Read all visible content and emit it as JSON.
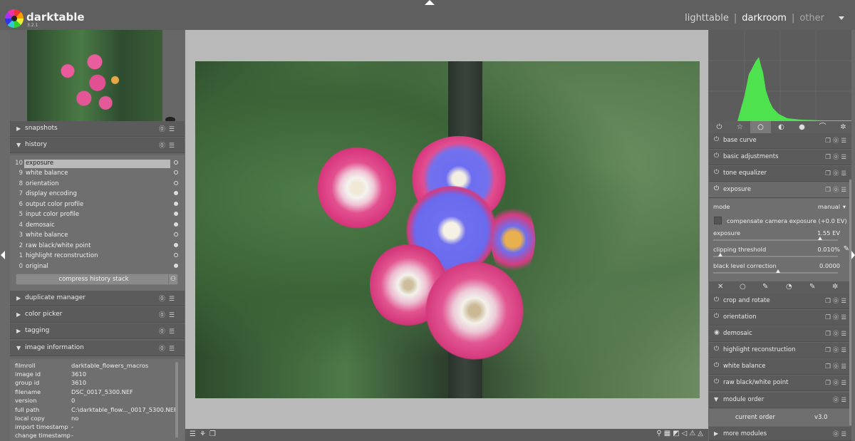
{
  "app": {
    "title": "darktable",
    "version": "3.2.1"
  },
  "views": {
    "lighttable": "lighttable",
    "sep1": "|",
    "darkroom": "darkroom",
    "sep2": "|",
    "other": "other"
  },
  "left_modules": {
    "snapshots": "snapshots",
    "history": "history",
    "duplicate_manager": "duplicate manager",
    "color_picker": "color picker",
    "tagging": "tagging",
    "image_information": "image information"
  },
  "history": [
    {
      "n": "10",
      "label": "exposure"
    },
    {
      "n": "9",
      "label": "white balance"
    },
    {
      "n": "8",
      "label": "orientation"
    },
    {
      "n": "7",
      "label": "display encoding"
    },
    {
      "n": "6",
      "label": "output color profile"
    },
    {
      "n": "5",
      "label": "input color profile"
    },
    {
      "n": "4",
      "label": "demosaic"
    },
    {
      "n": "3",
      "label": "white balance"
    },
    {
      "n": "2",
      "label": "raw black/white point"
    },
    {
      "n": "1",
      "label": "highlight reconstruction"
    },
    {
      "n": "0",
      "label": "original"
    }
  ],
  "compress_label": "compress history stack",
  "image_info": [
    {
      "k": "filmroll",
      "v": "darktable_flowers_macros"
    },
    {
      "k": "image id",
      "v": "3610"
    },
    {
      "k": "group id",
      "v": "3610"
    },
    {
      "k": "filename",
      "v": "DSC_0017_5300.NEF"
    },
    {
      "k": "version",
      "v": "0"
    },
    {
      "k": "full path",
      "v": "C:\\darktable_flow..._0017_5300.NEF"
    },
    {
      "k": "local copy",
      "v": "no"
    },
    {
      "k": "import timestamp",
      "v": "-"
    },
    {
      "k": "change timestamp",
      "v": "-"
    }
  ],
  "right_modules_top": [
    "base curve",
    "basic adjustments",
    "tone equalizer"
  ],
  "exposure_module": {
    "title": "exposure",
    "mode_label": "mode",
    "mode_value": "manual",
    "compensate_label": "compensate camera exposure (+0.0 EV)",
    "exposure_label": "exposure",
    "exposure_value": "1.55 EV",
    "exposure_level": 0.84,
    "clip_label": "clipping threshold",
    "clip_value": "0.010%",
    "clip_level": 0.04,
    "black_label": "black level correction",
    "black_value": "0.0000",
    "black_level": 0.5
  },
  "right_modules_bottom": [
    "crop and rotate",
    "orientation",
    "demosaic",
    "highlight reconstruction",
    "white balance",
    "raw black/white point"
  ],
  "module_order": {
    "label": "module order",
    "current_label": "current order",
    "current_value": "v3.0"
  },
  "more_modules": "more modules",
  "colors": {
    "bg": "#6a6a6a",
    "panel": "#676767",
    "histogram": "#4ee24e",
    "center": "#b9b9b9"
  }
}
